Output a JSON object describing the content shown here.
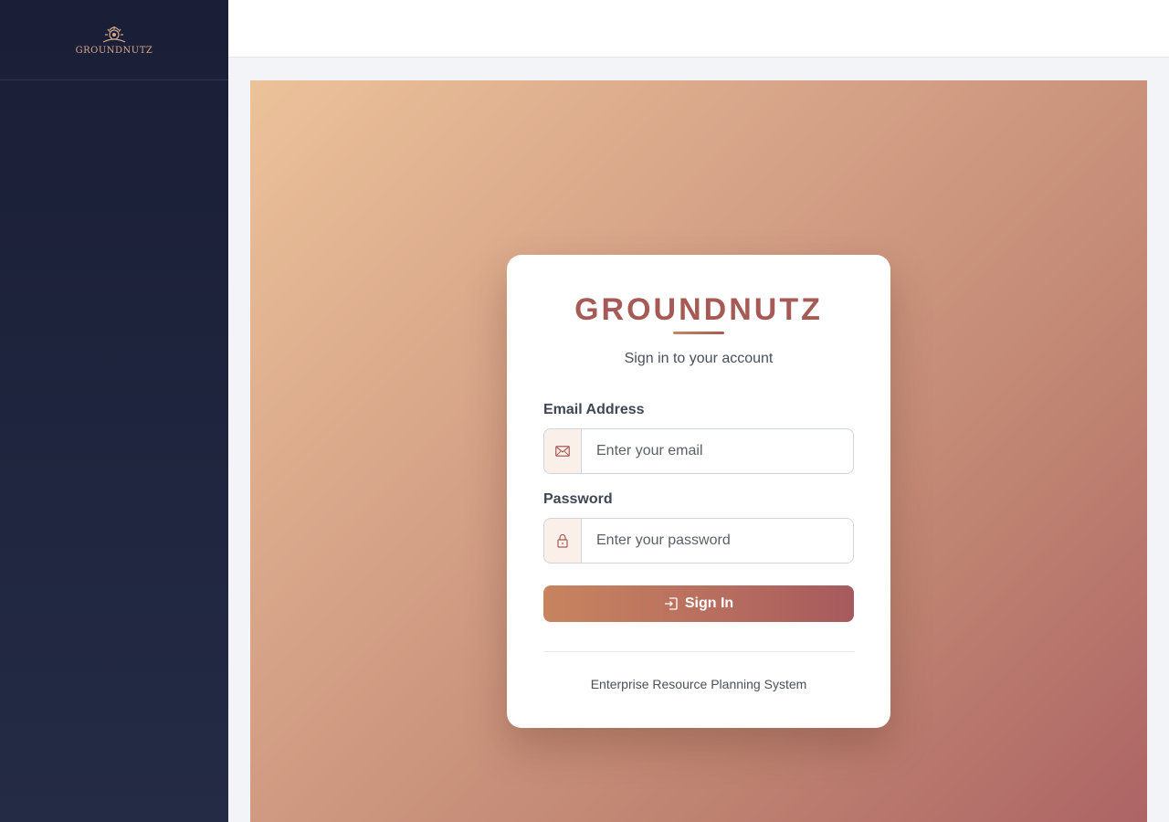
{
  "sidebar": {
    "logo_text": "GROUNDNUTZ"
  },
  "login": {
    "brand_title": "GROUNDNUTZ",
    "subtitle": "Sign in to your account",
    "email_label": "Email Address",
    "email_placeholder": "Enter your email",
    "email_value": "",
    "password_label": "Password",
    "password_placeholder": "Enter your password",
    "password_value": "",
    "submit_label": "Sign In",
    "footer": "Enterprise Resource Planning System"
  },
  "icons": {
    "logo": "groundnutz-logo-icon",
    "email": "envelope-icon",
    "password": "lock-icon",
    "submit": "sign-in-icon"
  },
  "colors": {
    "brand": "#a65a56",
    "accent": "#c7845f",
    "sidebar_bg": "#1a1e36"
  }
}
